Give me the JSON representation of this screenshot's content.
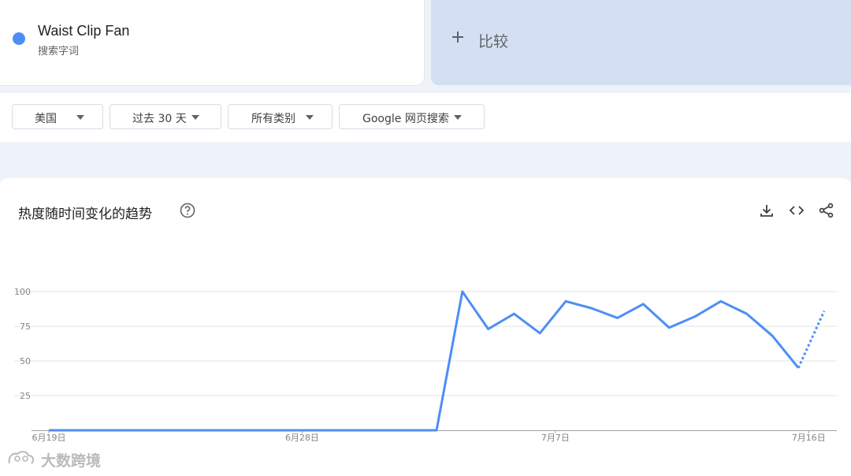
{
  "search_term": {
    "name": "Waist Clip Fan",
    "type": "搜索字词",
    "color": "#4e8ef4"
  },
  "compare": {
    "label": "比较",
    "icon": "plus-icon"
  },
  "filters": {
    "region": "美国",
    "time_range": "过去 30 天",
    "category": "所有类别",
    "search_type": "Google 网页搜索"
  },
  "chart_section": {
    "title": "热度随时间变化的趋势",
    "icons": [
      "help-icon",
      "download-icon",
      "embed-icon",
      "share-icon"
    ]
  },
  "chart_data": {
    "type": "line",
    "title": "",
    "xlabel": "",
    "ylabel": "",
    "ylim": [
      0,
      100
    ],
    "y_ticks": [
      "25",
      "50",
      "75",
      "100"
    ],
    "x_tick_labels": [
      "6月19日",
      "6月28日",
      "7月7日",
      "7月16日"
    ],
    "series": [
      {
        "color": "#4e8ef4",
        "values": [
          0,
          0,
          0,
          0,
          0,
          0,
          0,
          0,
          0,
          0,
          0,
          0,
          0,
          0,
          0,
          0,
          100,
          73,
          84,
          70,
          93,
          88,
          81,
          91,
          74,
          82,
          93,
          84,
          68,
          45,
          86
        ],
        "partial_last_point": true
      }
    ],
    "grid": true
  },
  "watermark": {
    "text": "大数跨境"
  }
}
